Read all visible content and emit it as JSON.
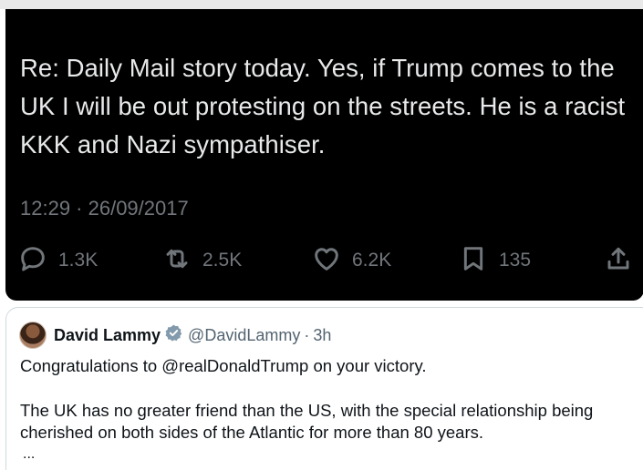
{
  "tweet": {
    "text": "Re: Daily Mail story today. Yes, if Trump comes to the UK I will be out protesting on the streets. He is a racist KKK and Nazi sympathiser.",
    "timestamp": "12:29 · 26/09/2017",
    "actions": {
      "replies": "1.3K",
      "reposts": "2.5K",
      "likes": "6.2K",
      "bookmarks": "135"
    }
  },
  "quote": {
    "name": "David Lammy",
    "handle": "@DavidLammy",
    "separator": "·",
    "time": "3h",
    "line1": "Congratulations to @realDonaldTrump on your victory.",
    "line2": "The UK has no greater friend than the US, with the special relationship being",
    "line3": "cherished on both sides of the Atlantic for more than 80 years.",
    "more": "..."
  },
  "colors": {
    "dark_bg": "#000000",
    "dark_text": "#e7e9ea",
    "muted": "#71767b",
    "verified_badge": "#829aab"
  },
  "icons": [
    "reply-icon",
    "repost-icon",
    "like-icon",
    "bookmark-icon",
    "share-icon",
    "verified-icon"
  ]
}
